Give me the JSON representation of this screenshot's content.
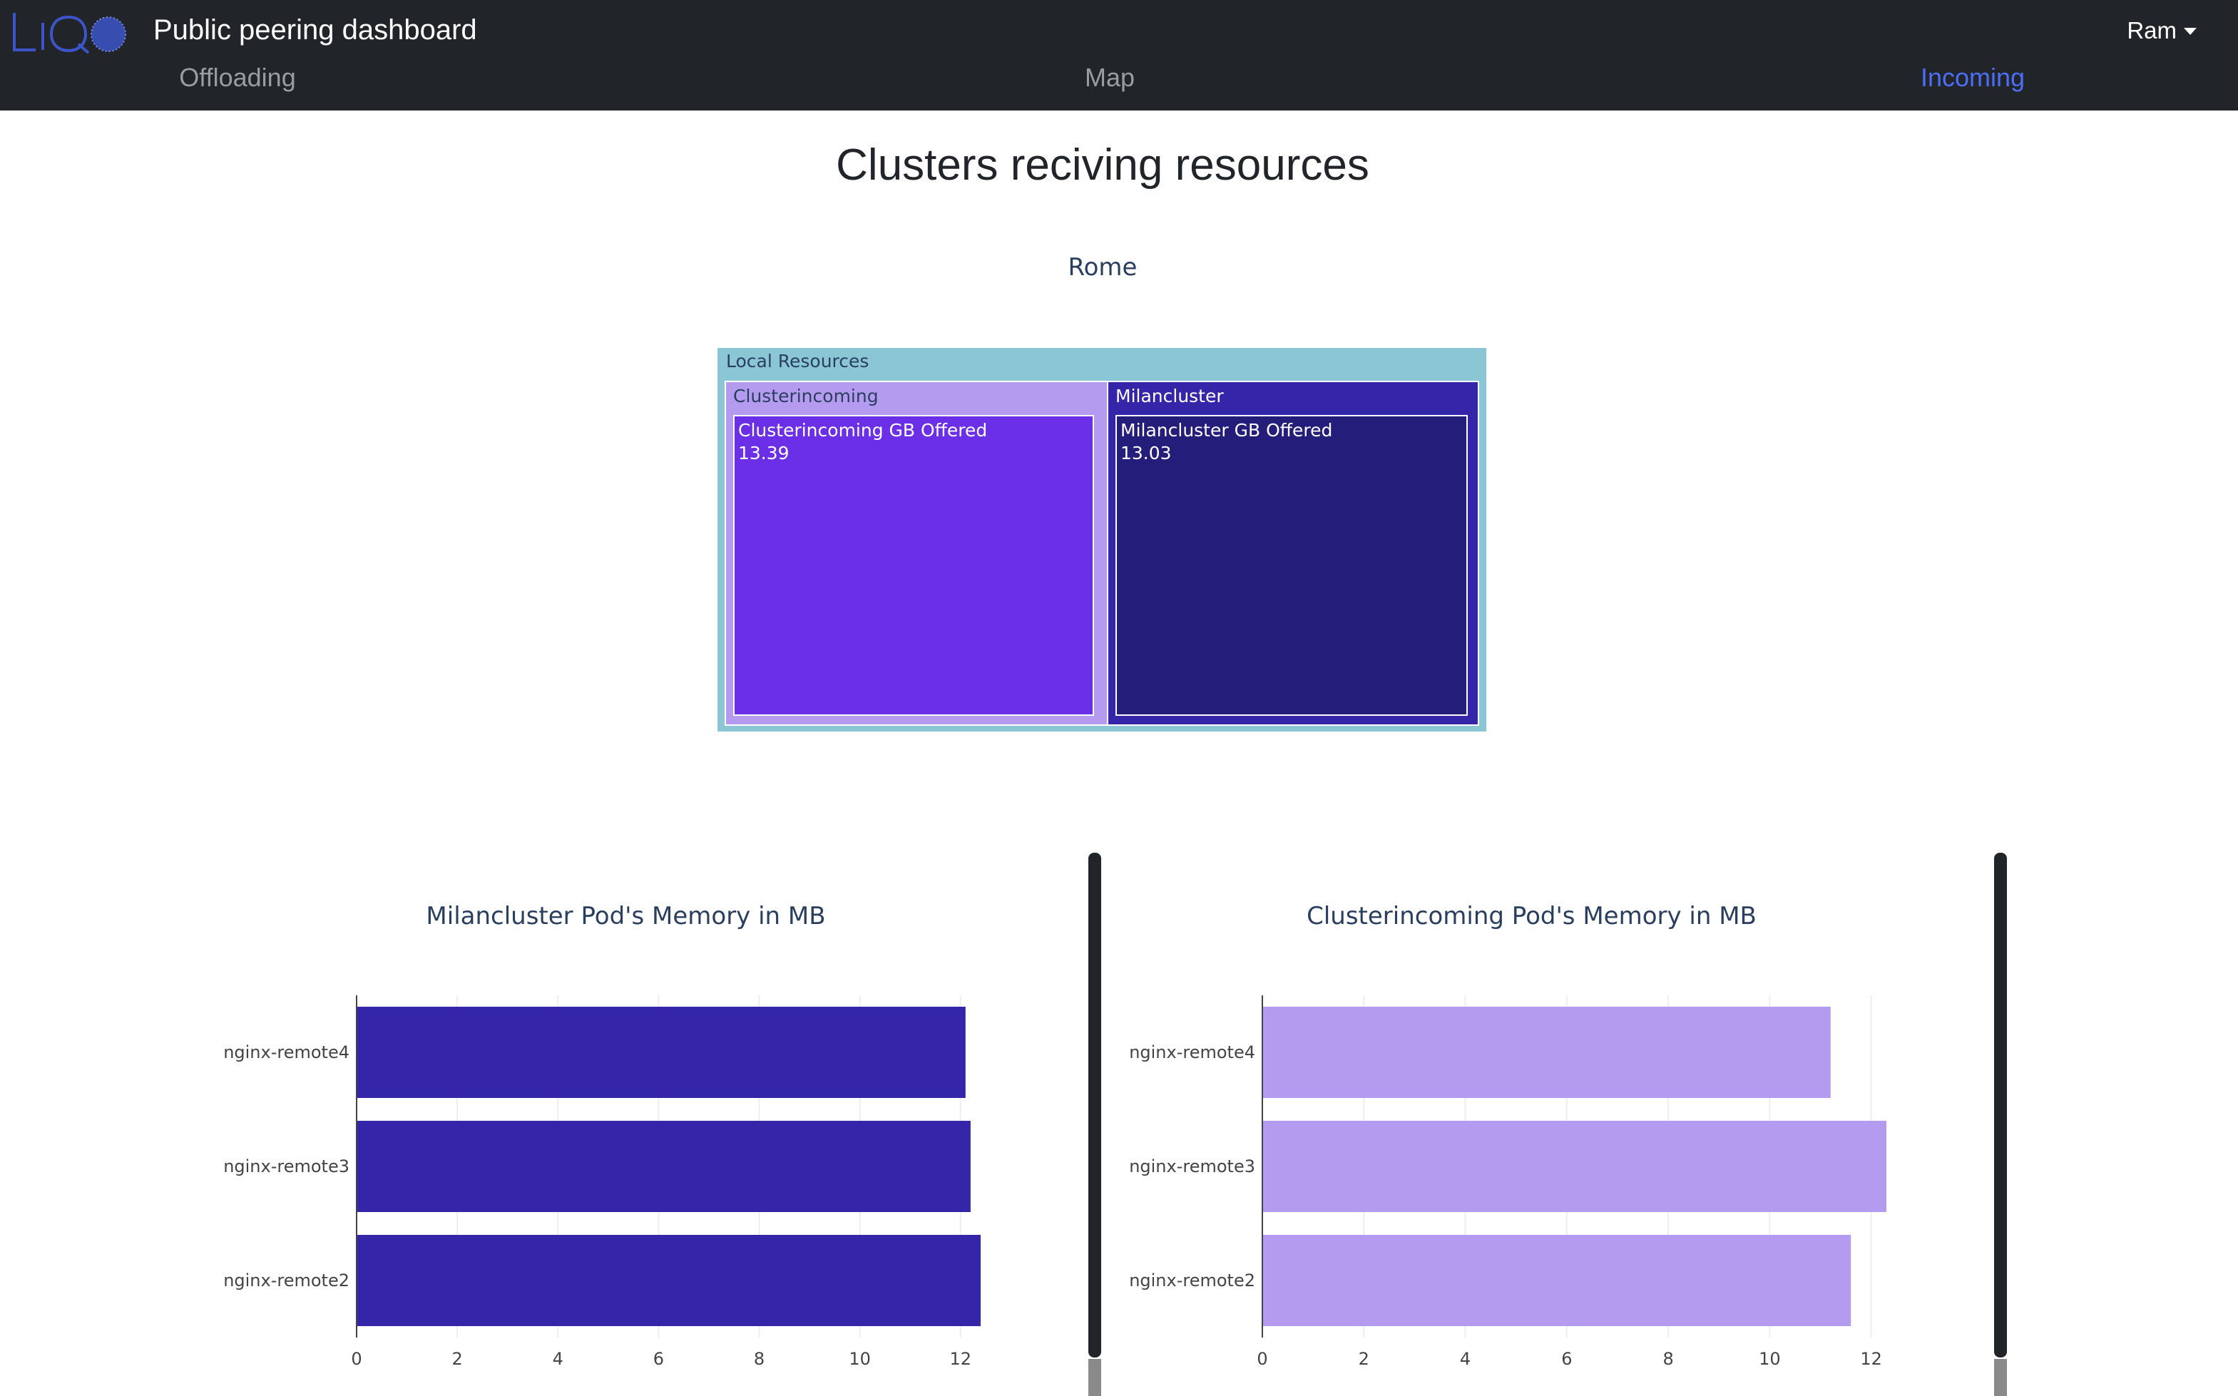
{
  "header": {
    "title": "Public peering dashboard",
    "user": "Ram",
    "tabs": [
      {
        "label": "Offloading",
        "active": false
      },
      {
        "label": "Map",
        "active": false
      },
      {
        "label": "Incoming",
        "active": true
      }
    ],
    "logo_icon": "liqo-logo-icon",
    "colors": {
      "bar": "#212529",
      "active_tab": "#4c6ef5",
      "inactive_tab": "#9a9d9f"
    }
  },
  "main": {
    "heading": "Clusters reciving resources"
  },
  "treemap": {
    "title": "Rome",
    "root_label": "Local Resources",
    "root_color": "#8ac6d4",
    "nodes": [
      {
        "label": "Clusterincoming",
        "leaf_label": "Clusterincoming  GB Offered",
        "value": "13.39",
        "color": "#b59bf0",
        "leaf_color": "#6a2fe6"
      },
      {
        "label": "Milancluster",
        "leaf_label": "Milancluster  GB Offered",
        "value": "13.03",
        "color": "#3526a9",
        "leaf_color": "#241d79"
      }
    ]
  },
  "chart_data": [
    {
      "type": "bar",
      "orientation": "horizontal",
      "title": "Milancluster Pod's Memory in MB",
      "categories": [
        "nginx-remote4",
        "nginx-remote3",
        "nginx-remote2"
      ],
      "values": [
        12.1,
        12.2,
        12.4
      ],
      "xlim": [
        0,
        12.4
      ],
      "xticks": [
        0,
        2,
        4,
        6,
        8,
        10,
        12
      ],
      "grid": true,
      "color": "#3526a9"
    },
    {
      "type": "bar",
      "orientation": "horizontal",
      "title": "Clusterincoming Pod's Memory in MB",
      "categories": [
        "nginx-remote4",
        "nginx-remote3",
        "nginx-remote2"
      ],
      "values": [
        11.2,
        12.3,
        11.6
      ],
      "xlim": [
        0,
        12.3
      ],
      "xticks": [
        0,
        2,
        4,
        6,
        8,
        10,
        12
      ],
      "grid": true,
      "color": "#b59bf0"
    }
  ]
}
